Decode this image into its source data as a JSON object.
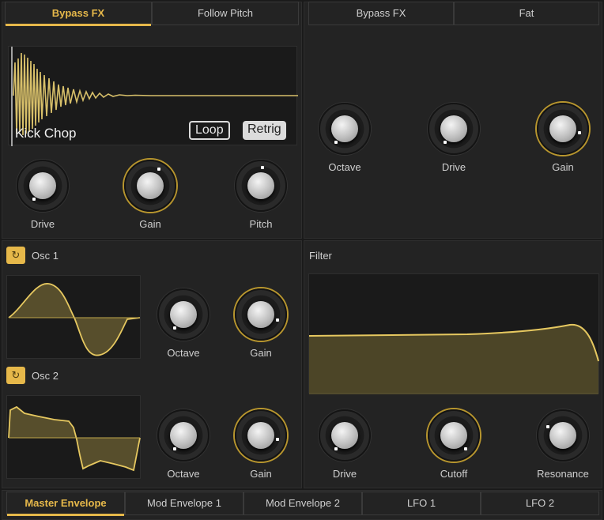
{
  "top_left": {
    "tabs": [
      {
        "label": "Bypass FX",
        "active": true
      },
      {
        "label": "Follow Pitch",
        "active": false
      }
    ],
    "sample": {
      "name": "Kick Chop",
      "loop_label": "Loop",
      "retrig_label": "Retrig"
    },
    "knobs": [
      {
        "label": "Drive"
      },
      {
        "label": "Gain"
      },
      {
        "label": "Pitch"
      }
    ]
  },
  "top_right": {
    "tabs": [
      {
        "label": "Bypass FX",
        "active": false
      },
      {
        "label": "Fat",
        "active": false
      }
    ],
    "knobs": [
      {
        "label": "Octave"
      },
      {
        "label": "Drive"
      },
      {
        "label": "Gain"
      }
    ]
  },
  "osc1": {
    "label": "Osc 1",
    "knobs": [
      {
        "label": "Octave"
      },
      {
        "label": "Gain"
      }
    ]
  },
  "osc2": {
    "label": "Osc 2",
    "knobs": [
      {
        "label": "Octave"
      },
      {
        "label": "Gain"
      }
    ]
  },
  "filter": {
    "label": "Filter",
    "knobs": [
      {
        "label": "Drive"
      },
      {
        "label": "Cutoff"
      },
      {
        "label": "Resonance"
      }
    ]
  },
  "bottom_tabs": [
    {
      "label": "Master Envelope",
      "active": true
    },
    {
      "label": "Mod Envelope 1",
      "active": false
    },
    {
      "label": "Mod Envelope 2",
      "active": false
    },
    {
      "label": "LFO 1",
      "active": false
    },
    {
      "label": "LFO 2",
      "active": false
    }
  ],
  "colors": {
    "accent": "#e6b84a",
    "background": "#1a1a1a",
    "panel": "#232323",
    "text": "#cfcfcf"
  },
  "icons": {
    "osc_icon": "power-cycle-icon"
  }
}
